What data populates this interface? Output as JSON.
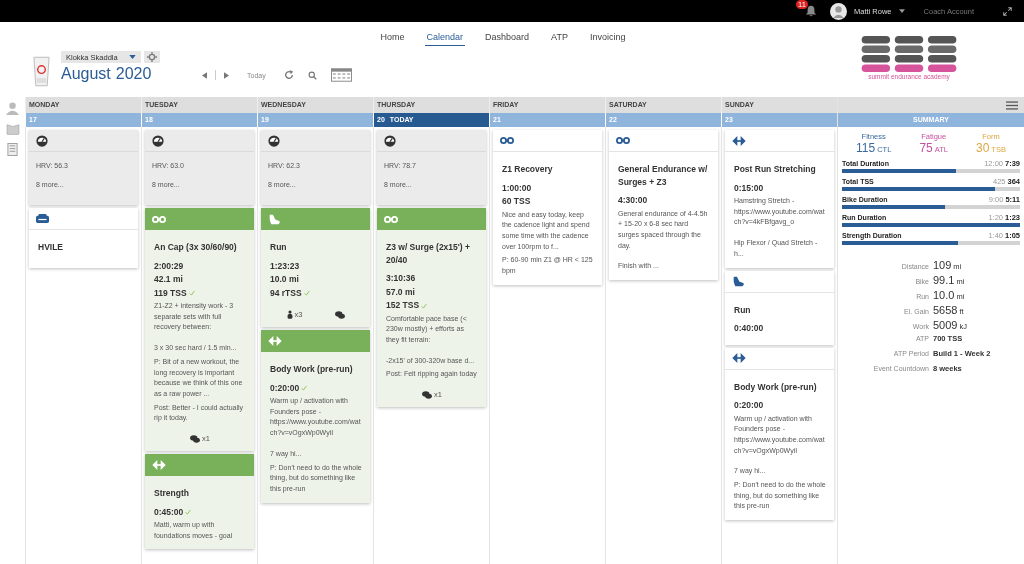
{
  "top_bar": {
    "notifications": "11",
    "user": "Matti Rowe",
    "account": "Coach Account"
  },
  "nav": {
    "items": [
      {
        "label": "Home",
        "selected": false
      },
      {
        "label": "Calendar",
        "selected": true
      },
      {
        "label": "Dashboard",
        "selected": false
      },
      {
        "label": "ATP",
        "selected": false
      },
      {
        "label": "Invoicing",
        "selected": false
      }
    ]
  },
  "header": {
    "athlete": "Klokka Skaddla",
    "month": "August",
    "year": "2020",
    "today_button": "Today",
    "logo_text": "summit endurance academy"
  },
  "days": [
    {
      "name": "MONDAY",
      "date": "17",
      "today": false,
      "items": [
        {
          "kind": "metrics",
          "lines": [
            "HRV: 56.3",
            "8 more..."
          ]
        },
        {
          "kind": "day_off",
          "title": "HVILE"
        }
      ]
    },
    {
      "name": "TUESDAY",
      "date": "18",
      "today": false,
      "items": [
        {
          "kind": "metrics",
          "lines": [
            "HRV: 63.0",
            "8 more..."
          ]
        },
        {
          "kind": "bike",
          "completed": true,
          "title": "An Cap (3x 30/60/90)",
          "stats": [
            {
              "text": "2:00:29",
              "check": false
            },
            {
              "text": "42.1 mi",
              "check": false
            },
            {
              "text": "119 TSS",
              "check": true
            }
          ],
          "description": [
            "Z1-Z2 + intensity work - 3 separate sets with full recovery between:",
            "3 x 30 sec hard / 1.5 min..."
          ],
          "notes": [
            "P: Bit of a new workout, the long recovery is important because we think of this one as a raw power ...",
            "Post: Better - I could actually rip it today."
          ],
          "footer": [
            {
              "kind": "comments",
              "count": "x1"
            }
          ]
        },
        {
          "kind": "strength",
          "completed": true,
          "title": "Strength",
          "stats": [
            {
              "text": "0:45:00",
              "check": true
            }
          ],
          "description": [
            "Matti, warm up with foundations moves - goal"
          ]
        }
      ]
    },
    {
      "name": "WEDNESDAY",
      "date": "19",
      "today": false,
      "items": [
        {
          "kind": "metrics",
          "lines": [
            "HRV: 62.3",
            "8 more..."
          ]
        },
        {
          "kind": "run",
          "completed": true,
          "title": "Run",
          "stats": [
            {
              "text": "1:23:23",
              "check": false
            },
            {
              "text": "10.0 mi",
              "check": false
            },
            {
              "text": "94 rTSS",
              "check": true
            }
          ],
          "footer": [
            {
              "kind": "equipment",
              "count": "x3"
            },
            {
              "kind": "comments"
            }
          ]
        },
        {
          "kind": "strength",
          "completed": true,
          "title": "Body Work (pre-run)",
          "stats": [
            {
              "text": "0:20:00",
              "check": true
            }
          ],
          "description": [
            "Warm up / activation with Founders pose - https://www.youtube.com/watch?v=vOgxWp0WyiI",
            "7 way hi..."
          ],
          "notes": [
            "P: Don't need to do the whole thing, but do something like this pre-run"
          ]
        }
      ]
    },
    {
      "name": "THURSDAY",
      "date": "20",
      "today": true,
      "today_label": "TODAY",
      "items": [
        {
          "kind": "metrics",
          "lines": [
            "HRV: 78.7",
            "8 more..."
          ]
        },
        {
          "kind": "bike",
          "completed": true,
          "title": "Z3 w/ Surge (2x15') + 20/40",
          "stats": [
            {
              "text": "3:10:36",
              "check": false
            },
            {
              "text": "57.0 mi",
              "check": false
            },
            {
              "text": "152 TSS",
              "check": true
            }
          ],
          "description": [
            "Comfortable pace base (< 230w mostly) + efforts as they fit terrain:",
            "-2x15' of 300-320w base d..."
          ],
          "notes": [
            "Post: Felt ripping again today"
          ],
          "footer": [
            {
              "kind": "comments",
              "count": "x1"
            }
          ]
        }
      ]
    },
    {
      "name": "FRIDAY",
      "date": "21",
      "today": false,
      "items": [
        {
          "kind": "bike",
          "completed": false,
          "title": "Z1 Recovery",
          "stats": [
            {
              "text": "1:00:00",
              "check": false
            },
            {
              "text": "60 TSS",
              "check": false
            }
          ],
          "description": [
            "Nice and easy today, keep the cadence light and spend some time with the cadence over 100rpm to f..."
          ],
          "notes": [
            "P: 60-90 min Z1 @ HR < 125 bpm"
          ]
        }
      ]
    },
    {
      "name": "SATURDAY",
      "date": "22",
      "today": false,
      "items": [
        {
          "kind": "bike",
          "completed": false,
          "title": "General Endurance w/ Surges + Z3",
          "stats": [
            {
              "text": "4:30:00",
              "check": false
            }
          ],
          "description": [
            "General endurance of 4-4.5h + 15-20 x 6-8 sec hard surges spaced through the day.",
            "Finish with ..."
          ]
        }
      ]
    },
    {
      "name": "SUNDAY",
      "date": "23",
      "today": false,
      "items": [
        {
          "kind": "strength",
          "completed": false,
          "title": "Post Run Stretching",
          "stats": [
            {
              "text": "0:15:00",
              "check": false
            }
          ],
          "description": [
            "Hamstring Stretch - https://www.youtube.com/watch?v=4kFBfgavg_o",
            "Hip Flexor / Quad Stretch - h..."
          ]
        },
        {
          "kind": "run",
          "completed": false,
          "title": "Run",
          "stats": [
            {
              "text": "0:40:00",
              "check": false
            }
          ]
        },
        {
          "kind": "strength",
          "completed": false,
          "title": "Body Work (pre-run)",
          "stats": [
            {
              "text": "0:20:00",
              "check": false
            }
          ],
          "description": [
            "Warm up / activation with Founders pose - https://www.youtube.com/watch?v=vOgxWp0WyiI",
            "7 way hi..."
          ],
          "notes": [
            "P: Don't need to do the whole thing, but do something like this pre-run"
          ]
        }
      ]
    }
  ],
  "summary": {
    "title": "SUMMARY",
    "metrics": [
      {
        "label": "Fitness",
        "value": "115",
        "unit": "CTL",
        "color": "#3b6a9e"
      },
      {
        "label": "Fatigue",
        "value": "75",
        "unit": "ATL",
        "color": "#c4519f"
      },
      {
        "label": "Form",
        "value": "30",
        "unit": "TSB",
        "color": "#dba743"
      }
    ],
    "bars": [
      {
        "label": "Total Duration",
        "planned": "12:00",
        "actual": "7:39",
        "level": 0.64
      },
      {
        "label": "Total TSS",
        "planned": "425",
        "actual": "364",
        "level": 0.86
      },
      {
        "label": "Bike Duration",
        "planned": "9:00",
        "actual": "5:11",
        "level": 0.58
      },
      {
        "label": "Run Duration",
        "planned": "1:20",
        "actual": "1:23",
        "level": 1.0
      },
      {
        "label": "Strength Duration",
        "planned": "1:40",
        "actual": "1:05",
        "level": 0.65
      }
    ],
    "stats": [
      {
        "label": "Distance",
        "value": "109",
        "unit": "mi",
        "kind": "big"
      },
      {
        "label": "Bike",
        "value": "99.1",
        "unit": "mi",
        "kind": "big"
      },
      {
        "label": "Run",
        "value": "10.0",
        "unit": "mi",
        "kind": "big"
      },
      {
        "label": "El. Gain",
        "value": "5658",
        "unit": "ft",
        "kind": "big"
      },
      {
        "label": "Work",
        "value": "5009",
        "unit": "kJ",
        "kind": "big"
      },
      {
        "label": "ATP",
        "value": "700 TSS",
        "kind": "small"
      },
      {
        "label": "ATP Period",
        "value": "Build 1 - Week 2",
        "kind": "small"
      },
      {
        "label": "Event Countdown",
        "value": "8 weeks",
        "kind": "small"
      }
    ]
  }
}
